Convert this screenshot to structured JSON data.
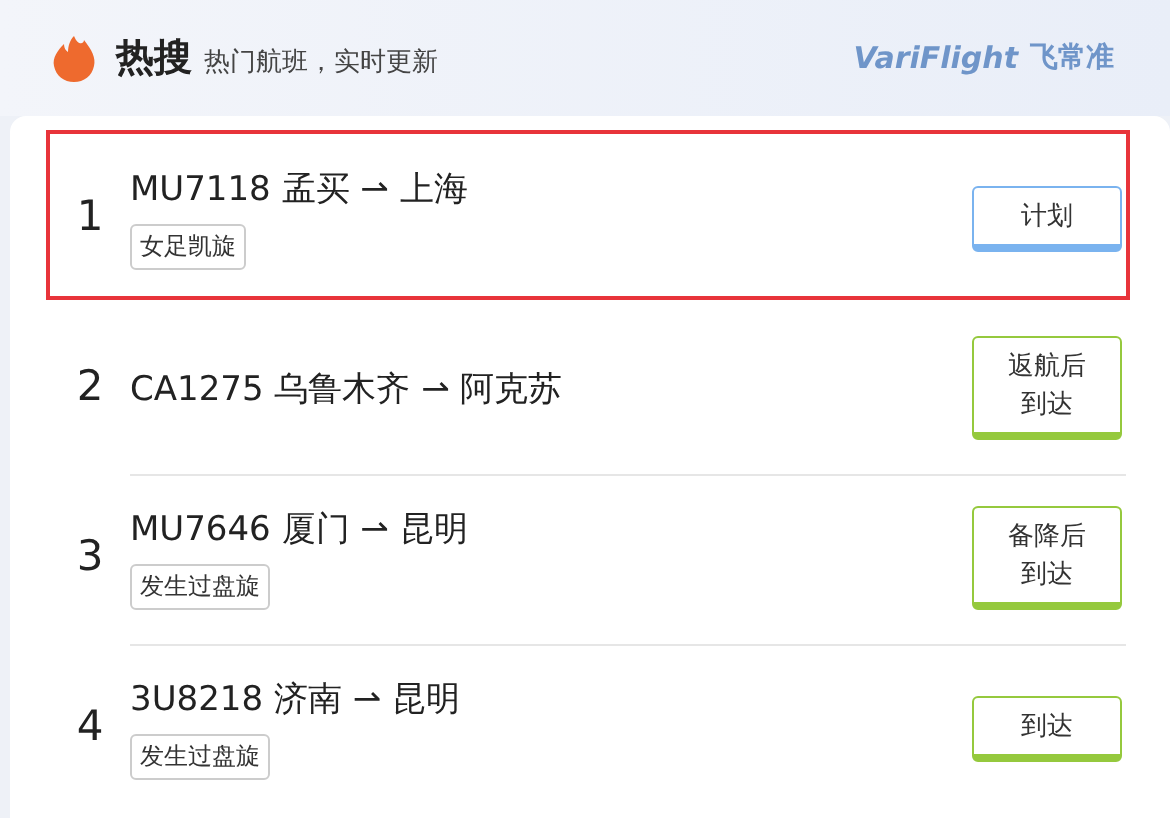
{
  "header": {
    "title": "热搜",
    "subtitle": "热门航班，实时更新",
    "brand_en": "VariFlight",
    "brand_cn": "飞常准"
  },
  "flights": [
    {
      "rank": "1",
      "route": "MU7118 孟买 ⇀ 上海",
      "tag": "女足凯旋",
      "status": [
        "计划"
      ],
      "color": "#7ab3ef",
      "selected": true
    },
    {
      "rank": "2",
      "route": "CA1275 乌鲁木齐 ⇀ 阿克苏",
      "status": [
        "返航后",
        "到达"
      ],
      "color": "#95c93d",
      "selected": false
    },
    {
      "rank": "3",
      "route": "MU7646 厦门 ⇀ 昆明",
      "tag": "发生过盘旋",
      "status": [
        "备降后",
        "到达"
      ],
      "color": "#95c93d",
      "selected": false
    },
    {
      "rank": "4",
      "route": "3U8218 济南 ⇀ 昆明",
      "tag": "发生过盘旋",
      "status": [
        "到达"
      ],
      "color": "#95c93d",
      "selected": false
    }
  ]
}
